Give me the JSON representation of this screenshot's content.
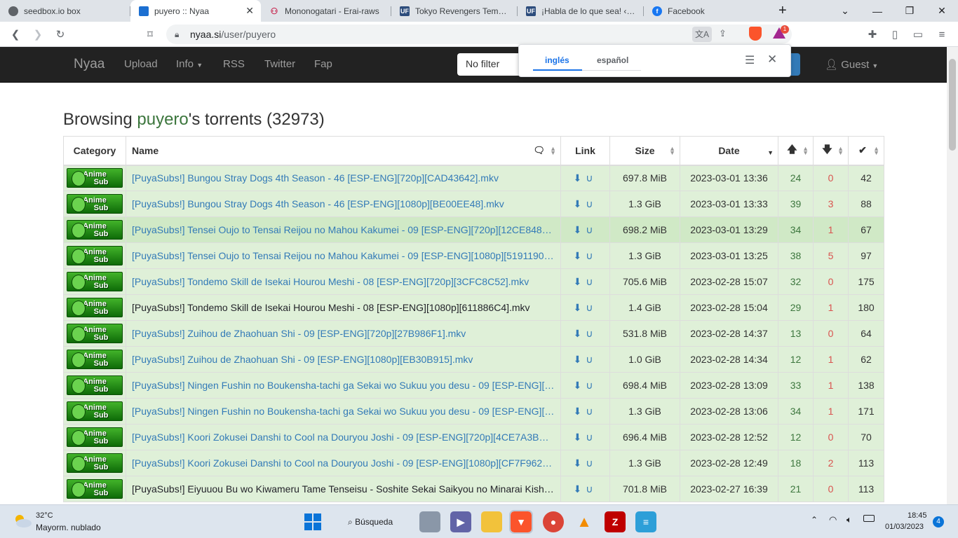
{
  "browser": {
    "tabs": [
      {
        "title": "seedbox.io box",
        "icon": "globe-icon"
      },
      {
        "title": "puyero :: Nyaa",
        "icon": "nyaa-icon",
        "active": true
      },
      {
        "title": "Mononogatari - Erai-raws",
        "icon": "erai-icon"
      },
      {
        "title": "Tokyo Revengers Temporad",
        "icon": "uf-icon"
      },
      {
        "title": "¡Habla de lo que sea! ‹ Unic",
        "icon": "uf-icon"
      },
      {
        "title": "Facebook",
        "icon": "facebook-icon"
      }
    ],
    "url_domain": "nyaa.si",
    "url_path": "/user/puyero",
    "brave_badge": "1"
  },
  "navbar": {
    "brand": "Nyaa",
    "items": [
      "Upload",
      "Info",
      "RSS",
      "Twitter",
      "Fap"
    ],
    "filter": "No filter",
    "user": "Guest"
  },
  "translate": {
    "source": "inglés",
    "target": "español"
  },
  "heading": {
    "prefix": "Browsing ",
    "user": "puyero",
    "suffix": "'s torrents (32973)"
  },
  "table": {
    "headers": {
      "category": "Category",
      "name": "Name",
      "link": "Link",
      "size": "Size",
      "date": "Date"
    },
    "category_label_1": "Anime",
    "category_label_2": "Sub",
    "rows": [
      {
        "name": "[PuyaSubs!] Bungou Stray Dogs 4th Season - 46 [ESP-ENG][720p][CAD43642].mkv",
        "size": "697.8 MiB",
        "date": "2023-03-01 13:36",
        "seeders": "24",
        "leechers": "0",
        "completed": "42"
      },
      {
        "name": "[PuyaSubs!] Bungou Stray Dogs 4th Season - 46 [ESP-ENG][1080p][BE00EE48].mkv",
        "size": "1.3 GiB",
        "date": "2023-03-01 13:33",
        "seeders": "39",
        "leechers": "3",
        "completed": "88"
      },
      {
        "name": "[PuyaSubs!] Tensei Oujo to Tensai Reijou no Mahou Kakumei - 09 [ESP-ENG][720p][12CE848…",
        "size": "698.2 MiB",
        "date": "2023-03-01 13:29",
        "seeders": "34",
        "leechers": "1",
        "completed": "67"
      },
      {
        "name": "[PuyaSubs!] Tensei Oujo to Tensai Reijou no Mahou Kakumei - 09 [ESP-ENG][1080p][5191190…",
        "size": "1.3 GiB",
        "date": "2023-03-01 13:25",
        "seeders": "38",
        "leechers": "5",
        "completed": "97"
      },
      {
        "name": "[PuyaSubs!] Tondemo Skill de Isekai Hourou Meshi - 08 [ESP-ENG][720p][3CFC8C52].mkv",
        "size": "705.6 MiB",
        "date": "2023-02-28 15:07",
        "seeders": "32",
        "leechers": "0",
        "completed": "175"
      },
      {
        "name": "[PuyaSubs!] Tondemo Skill de Isekai Hourou Meshi - 08 [ESP-ENG][1080p][611886C4].mkv",
        "size": "1.4 GiB",
        "date": "2023-02-28 15:04",
        "seeders": "29",
        "leechers": "1",
        "completed": "180"
      },
      {
        "name": "[PuyaSubs!] Zuihou de Zhaohuan Shi - 09 [ESP-ENG][720p][27B986F1].mkv",
        "size": "531.8 MiB",
        "date": "2023-02-28 14:37",
        "seeders": "13",
        "leechers": "0",
        "completed": "64"
      },
      {
        "name": "[PuyaSubs!] Zuihou de Zhaohuan Shi - 09 [ESP-ENG][1080p][EB30B915].mkv",
        "size": "1.0 GiB",
        "date": "2023-02-28 14:34",
        "seeders": "12",
        "leechers": "1",
        "completed": "62"
      },
      {
        "name": "[PuyaSubs!] Ningen Fushin no Boukensha-tachi ga Sekai wo Sukuu you desu - 09 [ESP-ENG][…",
        "size": "698.4 MiB",
        "date": "2023-02-28 13:09",
        "seeders": "33",
        "leechers": "1",
        "completed": "138"
      },
      {
        "name": "[PuyaSubs!] Ningen Fushin no Boukensha-tachi ga Sekai wo Sukuu you desu - 09 [ESP-ENG][…",
        "size": "1.3 GiB",
        "date": "2023-02-28 13:06",
        "seeders": "34",
        "leechers": "1",
        "completed": "171"
      },
      {
        "name": "[PuyaSubs!] Koori Zokusei Danshi to Cool na Douryou Joshi - 09 [ESP-ENG][720p][4CE7A3B…",
        "size": "696.4 MiB",
        "date": "2023-02-28 12:52",
        "seeders": "12",
        "leechers": "0",
        "completed": "70"
      },
      {
        "name": "[PuyaSubs!] Koori Zokusei Danshi to Cool na Douryou Joshi - 09 [ESP-ENG][1080p][CF7F962…",
        "size": "1.3 GiB",
        "date": "2023-02-28 12:49",
        "seeders": "18",
        "leechers": "2",
        "completed": "113"
      },
      {
        "name": "[PuyaSubs!] Eiyuuou Bu wo Kiwameru Tame Tenseisu - Soshite Sekai Saikyou no Minarai Kish…",
        "size": "701.8 MiB",
        "date": "2023-02-27 16:39",
        "seeders": "21",
        "leechers": "0",
        "completed": "113"
      }
    ]
  },
  "taskbar": {
    "temperature": "32°C",
    "weather": "Mayorm. nublado",
    "search": "Búsqueda",
    "time": "18:45",
    "date": "01/03/2023",
    "notifications": "4"
  }
}
